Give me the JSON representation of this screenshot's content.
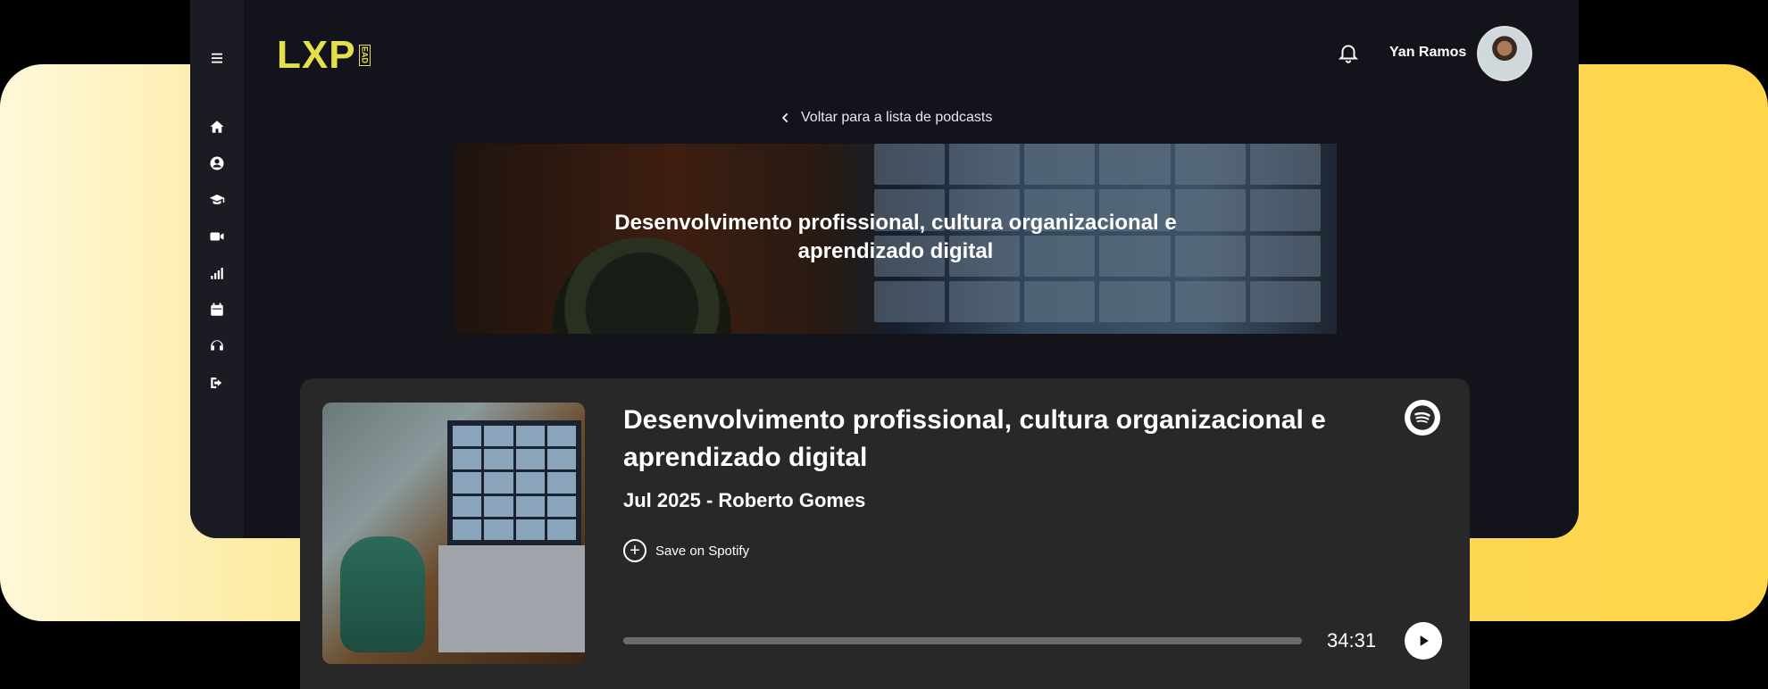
{
  "header": {
    "logo_text": "LXP",
    "logo_badge": "EAD",
    "user_name": "Yan Ramos"
  },
  "sidebar": {
    "items": [
      {
        "icon": "menu-icon"
      },
      {
        "icon": "home-icon"
      },
      {
        "icon": "user-icon"
      },
      {
        "icon": "graduation-cap-icon"
      },
      {
        "icon": "video-icon"
      },
      {
        "icon": "signal-icon"
      },
      {
        "icon": "calendar-icon"
      },
      {
        "icon": "headphones-icon"
      },
      {
        "icon": "logout-icon"
      }
    ]
  },
  "page": {
    "back_link": "Voltar para a lista de podcasts",
    "banner_title_line1": "Desenvolvimento profissional, cultura organizacional e",
    "banner_title_line2": "aprendizado digital"
  },
  "podcast": {
    "title_line1": "Desenvolvimento profissional, cultura organizacional e",
    "title_line2": "aprendizado digital",
    "meta": "Jul 2025 - Roberto Gomes",
    "save_label": "Save on Spotify",
    "duration": "34:31",
    "progress_fraction": 0.0
  },
  "colors": {
    "accent": "#e4e04a",
    "card_bg": "#282828",
    "app_bg": "#13131b"
  }
}
